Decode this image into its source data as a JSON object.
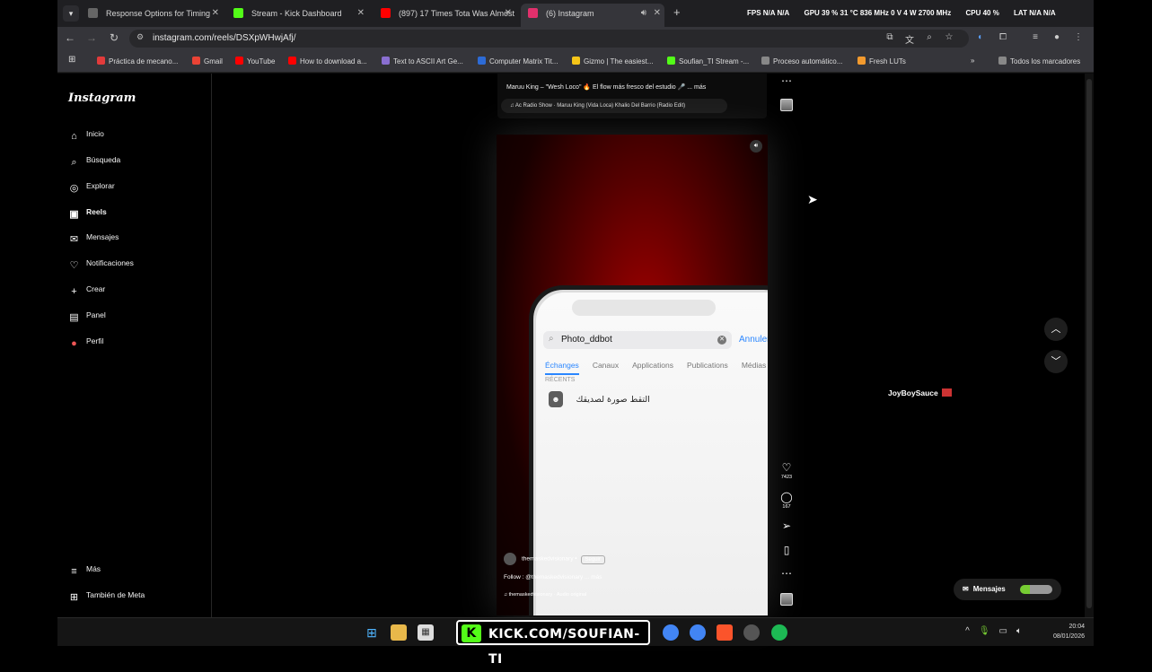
{
  "tabs": [
    {
      "title": "Response Options for Timing",
      "color": "#666666"
    },
    {
      "title": "Stream - Kick Dashboard",
      "color": "#53fc18"
    },
    {
      "title": "(897) 17 Times Tota Was Almost",
      "color": "#ff0000"
    },
    {
      "title": "(6) Instagram",
      "color": "#e1306c"
    }
  ],
  "stats": {
    "fps": "FPS  N/A  N/A",
    "gpu": "GPU 39 %  31 °C  836 MHz  0 V  4 W  2700 MHz",
    "cpu": "CPU 40 %",
    "lat": "LAT  N/A  N/A"
  },
  "url": "instagram.com/reels/DSXpWHwjAfj/",
  "bookmarks": [
    {
      "label": "Práctica de mecano...",
      "color": "#e23b3b"
    },
    {
      "label": "Gmail",
      "color": "#ea4335"
    },
    {
      "label": "YouTube",
      "color": "#ff0000"
    },
    {
      "label": "How to download a...",
      "color": "#ff0000"
    },
    {
      "label": "Text to ASCII Art Ge...",
      "color": "#8a6fd1"
    },
    {
      "label": "Computer Matrix Tit...",
      "color": "#2d6bd6"
    },
    {
      "label": "Gizmo | The easiest...",
      "color": "#f5c518"
    },
    {
      "label": "Soufian_TI Stream -...",
      "color": "#53fc18"
    },
    {
      "label": "Proceso automático...",
      "color": "#888888"
    },
    {
      "label": "Fresh LUTs",
      "color": "#f29a2e"
    }
  ],
  "all_bookmarks": "Todos los marcadores",
  "sidebar": {
    "logo": "Instagram",
    "items": [
      {
        "label": "Inicio",
        "icon": "home-icon"
      },
      {
        "label": "Búsqueda",
        "icon": "search-icon"
      },
      {
        "label": "Explorar",
        "icon": "compass-icon"
      },
      {
        "label": "Reels",
        "icon": "reels-icon"
      },
      {
        "label": "Mensajes",
        "icon": "messenger-icon"
      },
      {
        "label": "Notificaciones",
        "icon": "heart-icon"
      },
      {
        "label": "Crear",
        "icon": "plus-icon"
      },
      {
        "label": "Panel",
        "icon": "dashboard-icon"
      },
      {
        "label": "Perfil",
        "icon": "profile-icon"
      }
    ],
    "more": "Más",
    "meta": "También de Meta"
  },
  "prev_reel": {
    "caption": "Maruu King – \"Wesh Loco\" 🔥 El flow más fresco del estudio 🎤 ... más",
    "audio": "♫ Ac Radio Show · Maruu King (Vida Loca) Khalio Del Barrio (Radio Edit)"
  },
  "reel": {
    "search_value": "Photo_ddbot",
    "cancel": "Annuler",
    "tabs": [
      "Échanges",
      "Canaux",
      "Applications",
      "Publications",
      "Médias"
    ],
    "recents_label": "RÉCENTS",
    "recent_item": "التقط صورة لصديقك",
    "username": "themaskedvisionary",
    "follow": "Seguir",
    "caption": "Follow : @themaskedvisionary ... más",
    "audio": "♫ themaskedvisionary · Audio original",
    "likes": "7423",
    "comments": "167"
  },
  "suggested_user": "JoyBoySauce",
  "messages_pill": "Mensajes",
  "clock": {
    "time": "20:04",
    "date": "08/01/2026"
  },
  "kick_banner": "KICK.COM/SOUFIAN-TI"
}
